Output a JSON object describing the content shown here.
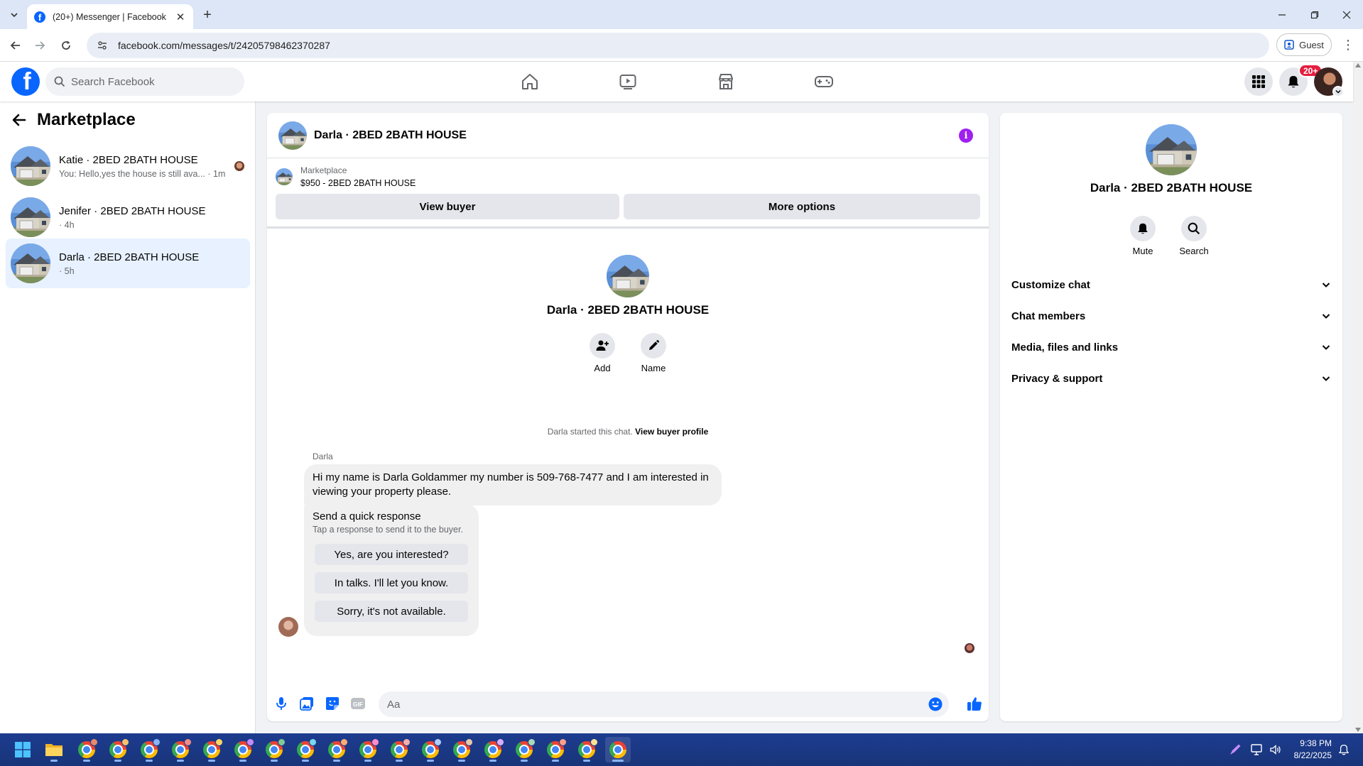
{
  "browser": {
    "tab_title": "(20+) Messenger | Facebook",
    "url": "facebook.com/messages/t/24205798462370287",
    "profile_label": "Guest"
  },
  "header": {
    "search_placeholder": "Search Facebook",
    "notification_badge": "20+"
  },
  "sidebar": {
    "title": "Marketplace",
    "conversations": [
      {
        "name": "Katie · 2BED 2BATH HOUSE",
        "preview": "You: Hello,yes the house is still ava... · 1m",
        "active": false
      },
      {
        "name": "Jenifer · 2BED 2BATH HOUSE",
        "preview": "· 4h",
        "active": false
      },
      {
        "name": "Darla · 2BED 2BATH HOUSE",
        "preview": "· 5h",
        "active": true
      }
    ]
  },
  "chat": {
    "title": "Darla · 2BED 2BATH HOUSE",
    "marketplace_label": "Marketplace",
    "listing": "$950 - 2BED 2BATH HOUSE",
    "view_buyer_label": "View buyer",
    "more_options_label": "More options",
    "profile_name": "Darla · 2BED 2BATH HOUSE",
    "add_label": "Add",
    "name_label": "Name",
    "started_text": "Darla started this chat.",
    "view_buyer_profile_label": "View buyer profile",
    "sender_name": "Darla",
    "message": "Hi my name is Darla Goldammer my number is 509-768-7477 and I am interested in viewing your property please.",
    "quick_title": "Send a quick response",
    "quick_subtitle": "Tap a response to send it to the buyer.",
    "quick_responses": [
      "Yes, are you interested?",
      "In talks. I'll let you know.",
      "Sorry, it's not available."
    ],
    "composer_placeholder": "Aa"
  },
  "info_panel": {
    "name": "Darla · 2BED 2BATH HOUSE",
    "mute_label": "Mute",
    "search_label": "Search",
    "sections": [
      "Customize chat",
      "Chat members",
      "Media, files and links",
      "Privacy & support"
    ]
  },
  "taskbar": {
    "time": "9:38 PM",
    "date": "8/22/2025"
  },
  "colors": {
    "facebook_blue": "#0866ff",
    "active_conversation": "#e7f1ff",
    "notification_red": "#e41e3f",
    "info_purple": "#a020f0"
  }
}
